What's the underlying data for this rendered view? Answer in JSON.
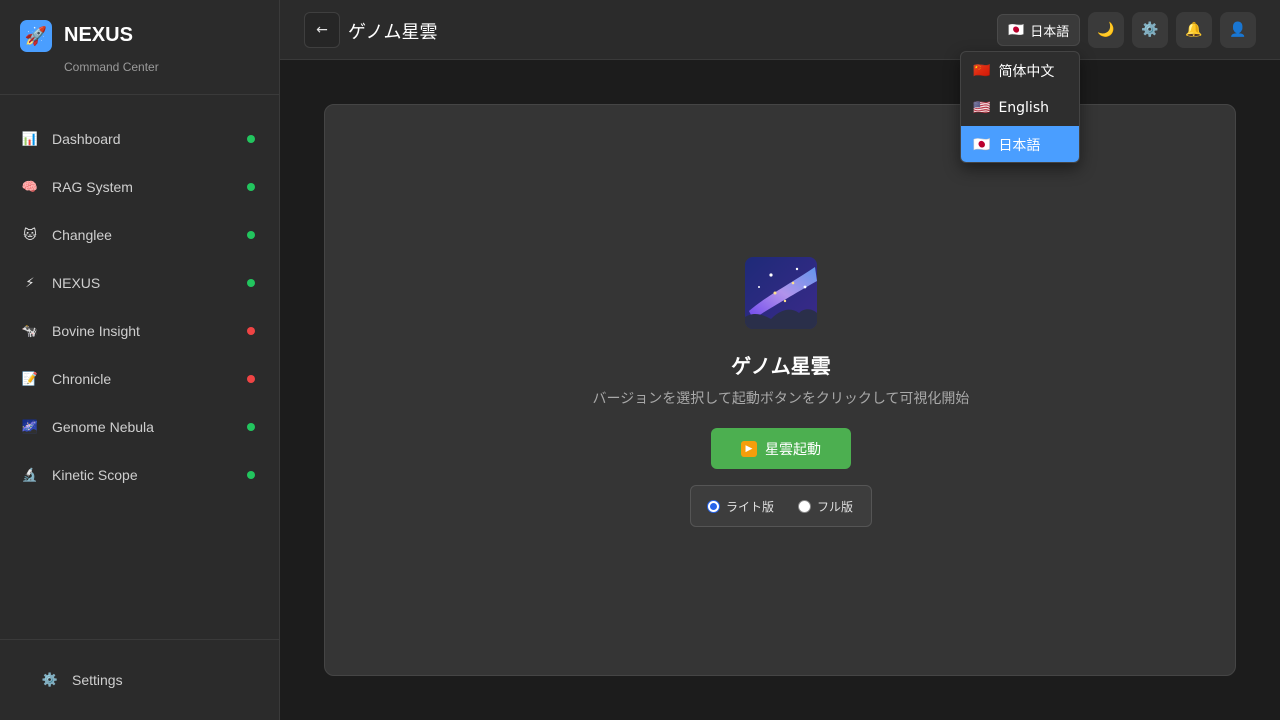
{
  "brand": {
    "name": "NEXUS",
    "subtitle": "Command Center",
    "logo_icon": "rocket-icon"
  },
  "sidebar": {
    "items": [
      {
        "label": "Dashboard",
        "icon": "chart-icon",
        "glyph": "📊",
        "status": "online"
      },
      {
        "label": "RAG System",
        "icon": "brain-icon",
        "glyph": "🧠",
        "status": "online"
      },
      {
        "label": "Changlee",
        "icon": "cat-icon",
        "glyph": "🐱",
        "status": "online"
      },
      {
        "label": "NEXUS",
        "icon": "lightning-icon",
        "glyph": "⚡",
        "status": "online"
      },
      {
        "label": "Bovine Insight",
        "icon": "cow-icon",
        "glyph": "🐄",
        "status": "offline"
      },
      {
        "label": "Chronicle",
        "icon": "memo-icon",
        "glyph": "📝",
        "status": "offline"
      },
      {
        "label": "Genome Nebula",
        "icon": "milky-way-icon",
        "glyph": "🌌",
        "status": "online"
      },
      {
        "label": "Kinetic Scope",
        "icon": "microscope-icon",
        "glyph": "🔬",
        "status": "online"
      }
    ],
    "footer": {
      "label": "Settings",
      "icon": "gear-icon",
      "glyph": "⚙️"
    }
  },
  "header": {
    "back_glyph": "←",
    "title": "ゲノム星雲",
    "language": {
      "flag": "🇯🇵",
      "label": "日本語"
    },
    "theme_glyph": "🌙",
    "settings_glyph": "⚙️",
    "bell_glyph": "🔔",
    "user_glyph": "👤"
  },
  "language_menu": {
    "options": [
      {
        "flag": "🇨🇳",
        "label": "简体中文",
        "selected": false
      },
      {
        "flag": "🇺🇸",
        "label": "English",
        "selected": false
      },
      {
        "flag": "🇯🇵",
        "label": "日本語",
        "selected": true
      }
    ]
  },
  "main": {
    "title": "ゲノム星雲",
    "description": "バージョンを選択して起動ボタンをクリックして可視化開始",
    "launch_label": "星雲起動",
    "play_glyph": "▶",
    "versions": [
      {
        "label": "ライト版",
        "checked": true
      },
      {
        "label": "フル版",
        "checked": false
      }
    ]
  },
  "colors": {
    "accent": "#4a9eff",
    "launch": "#4caf50",
    "status_online": "#22c55e",
    "status_offline": "#ef4444"
  }
}
